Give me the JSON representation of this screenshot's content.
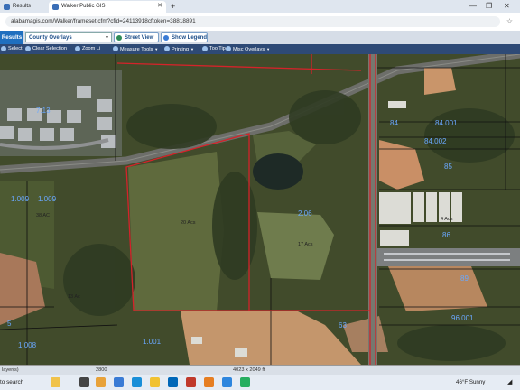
{
  "browser": {
    "tabs": [
      {
        "label": "Results",
        "active": false
      },
      {
        "label": "Walker Public GIS",
        "active": true
      }
    ],
    "new_tab_glyph": "+",
    "url": "alabamagis.com/Walker/frameset.cfm?cfid=24113918cftoken=38818891",
    "window_controls": [
      "—",
      "❐",
      "✕"
    ]
  },
  "gis": {
    "results_label": "Results",
    "overlay_select": "County Overlays",
    "street_view_label": "Street View",
    "show_legend_label": "Show Legend",
    "tools": [
      {
        "label": "Select",
        "icon": "select-icon",
        "dropdown": false
      },
      {
        "label": "Clear Selection",
        "icon": "clear-icon",
        "dropdown": false
      },
      {
        "label": "Zoom Li",
        "icon": "zoom-icon",
        "dropdown": false
      },
      {
        "label": "Measure Tools",
        "icon": "ruler-icon",
        "dropdown": true
      },
      {
        "label": "Printing",
        "icon": "printer-icon",
        "dropdown": true
      },
      {
        "label": "ToolTip",
        "icon": "tooltip-icon",
        "dropdown": false
      },
      {
        "label": "Misc Overlays",
        "icon": "layers-icon",
        "dropdown": true
      }
    ]
  },
  "map": {
    "parcel_labels": [
      {
        "text": "7.13",
        "kind": "blue"
      },
      {
        "text": "1.009",
        "kind": "blue"
      },
      {
        "text": "1.009",
        "kind": "blue"
      },
      {
        "text": "38 AC",
        "kind": "small"
      },
      {
        "text": "13 Ac",
        "kind": "small"
      },
      {
        "text": "20 Acs",
        "kind": "small"
      },
      {
        "text": "2.06",
        "kind": "blue"
      },
      {
        "text": "17 Acs",
        "kind": "small"
      },
      {
        "text": "84",
        "kind": "blue"
      },
      {
        "text": "84.001",
        "kind": "blue"
      },
      {
        "text": "84.002",
        "kind": "blue"
      },
      {
        "text": "85",
        "kind": "blue"
      },
      {
        "text": "4 Acs",
        "kind": "small"
      },
      {
        "text": "86",
        "kind": "blue"
      },
      {
        "text": "89",
        "kind": "blue"
      },
      {
        "text": "96.001",
        "kind": "blue"
      },
      {
        "text": "5",
        "kind": "blue"
      },
      {
        "text": "1.001",
        "kind": "blue"
      },
      {
        "text": "1.008",
        "kind": "blue"
      },
      {
        "text": "63",
        "kind": "blue"
      }
    ]
  },
  "status": {
    "layers": "layer(s)",
    "scale": "2800",
    "dimensions": "4023 x 2049 ft"
  },
  "taskbar": {
    "search_label": "to search",
    "weather": "46°F  Sunny"
  }
}
